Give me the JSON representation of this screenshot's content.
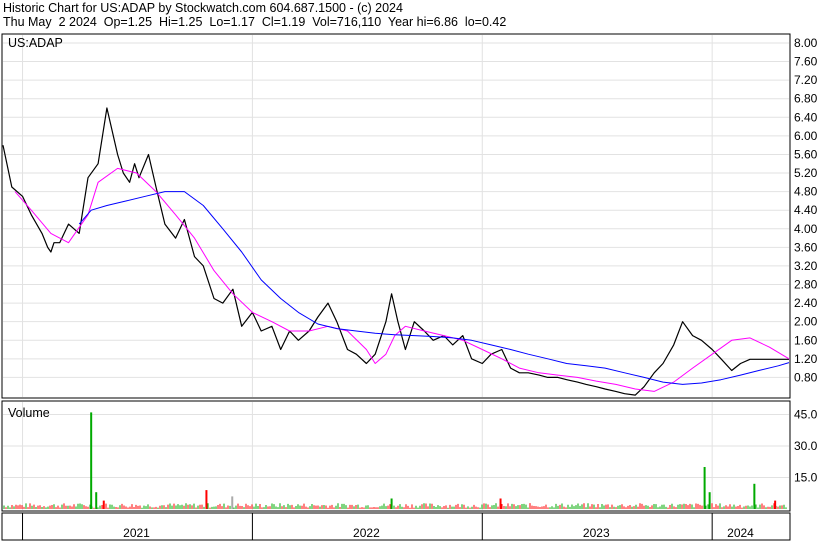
{
  "header": {
    "line1": "Historic Chart for US:ADAP by Stockwatch.com 604.687.1500 - (c) 2024",
    "line2": "Thu May  2 2024  Op=1.25  Hi=1.25  Lo=1.17  Cl=1.19  Vol=716,110  Year hi=6.86  lo=0.42"
  },
  "chart_data": [
    {
      "type": "line",
      "title": "US:ADAP",
      "yticks": [
        "8.00",
        "7.60",
        "7.20",
        "6.80",
        "6.40",
        "6.00",
        "5.60",
        "5.20",
        "4.80",
        "4.40",
        "4.00",
        "3.60",
        "3.20",
        "2.80",
        "2.40",
        "2.00",
        "1.60",
        "1.20",
        "0.80"
      ],
      "ylim": [
        0.4,
        8.15
      ],
      "grid": true,
      "series": [
        {
          "key": "price",
          "color": "#000000",
          "x": [
            "2020-12-01",
            "2020-12-15",
            "2021-01-01",
            "2021-01-15",
            "2021-02-01",
            "2021-02-10",
            "2021-02-15",
            "2021-02-20",
            "2021-03-01",
            "2021-03-15",
            "2021-04-01",
            "2021-04-15",
            "2021-05-01",
            "2021-05-15",
            "2021-06-01",
            "2021-06-10",
            "2021-06-20",
            "2021-06-28",
            "2021-07-05",
            "2021-07-20",
            "2021-08-01",
            "2021-08-15",
            "2021-09-01",
            "2021-09-15",
            "2021-10-01",
            "2021-10-15",
            "2021-11-01",
            "2021-11-15",
            "2021-12-01",
            "2021-12-15",
            "2022-01-01",
            "2022-01-15",
            "2022-02-01",
            "2022-02-15",
            "2022-03-01",
            "2022-03-15",
            "2022-04-01",
            "2022-04-15",
            "2022-05-01",
            "2022-05-15",
            "2022-06-01",
            "2022-06-15",
            "2022-07-01",
            "2022-07-15",
            "2022-08-01",
            "2022-08-10",
            "2022-08-20",
            "2022-09-01",
            "2022-09-15",
            "2022-10-01",
            "2022-10-15",
            "2022-11-01",
            "2022-11-15",
            "2022-12-01",
            "2022-12-15",
            "2023-01-01",
            "2023-01-15",
            "2023-02-01",
            "2023-02-15",
            "2023-03-01",
            "2023-03-15",
            "2023-04-01",
            "2023-04-15",
            "2023-05-01",
            "2023-05-15",
            "2023-06-01",
            "2023-06-15",
            "2023-07-01",
            "2023-07-15",
            "2023-08-01",
            "2023-08-15",
            "2023-09-01",
            "2023-09-15",
            "2023-10-01",
            "2023-10-15",
            "2023-11-01",
            "2023-11-15",
            "2023-12-01",
            "2023-12-15",
            "2024-01-01",
            "2024-01-15",
            "2024-02-01",
            "2024-02-15",
            "2024-03-01",
            "2024-03-15",
            "2024-04-01",
            "2024-04-15",
            "2024-05-02"
          ],
          "y": [
            5.8,
            4.9,
            4.7,
            4.3,
            3.9,
            3.6,
            3.5,
            3.7,
            3.7,
            4.1,
            3.9,
            5.1,
            5.4,
            6.6,
            5.6,
            5.2,
            5.0,
            5.4,
            5.1,
            5.6,
            4.9,
            4.1,
            3.8,
            4.2,
            3.4,
            3.2,
            2.5,
            2.4,
            2.7,
            1.9,
            2.2,
            1.8,
            1.9,
            1.4,
            1.8,
            1.6,
            1.8,
            2.1,
            2.4,
            2.0,
            1.4,
            1.3,
            1.1,
            1.3,
            2.0,
            2.6,
            2.0,
            1.4,
            2.0,
            1.8,
            1.6,
            1.7,
            1.5,
            1.7,
            1.2,
            1.1,
            1.3,
            1.4,
            1.0,
            0.9,
            0.9,
            0.85,
            0.8,
            0.8,
            0.75,
            0.7,
            0.65,
            0.6,
            0.55,
            0.5,
            0.45,
            0.42,
            0.6,
            0.9,
            1.1,
            1.5,
            2.0,
            1.7,
            1.6,
            1.4,
            1.2,
            0.95,
            1.1,
            1.19,
            1.19,
            1.19,
            1.19,
            1.19
          ]
        },
        {
          "key": "ma_short",
          "color": "#ff00ff",
          "x": [
            "2020-12-20",
            "2021-01-15",
            "2021-02-15",
            "2021-03-15",
            "2021-04-15",
            "2021-05-01",
            "2021-06-01",
            "2021-07-01",
            "2021-08-01",
            "2021-09-01",
            "2021-10-01",
            "2021-11-01",
            "2021-12-01",
            "2022-01-01",
            "2022-02-01",
            "2022-03-01",
            "2022-04-01",
            "2022-05-01",
            "2022-06-01",
            "2022-07-01",
            "2022-07-15",
            "2022-08-01",
            "2022-08-15",
            "2022-09-01",
            "2022-10-01",
            "2022-11-01",
            "2022-12-01",
            "2023-01-01",
            "2023-02-01",
            "2023-03-01",
            "2023-04-01",
            "2023-05-01",
            "2023-06-01",
            "2023-07-01",
            "2023-08-01",
            "2023-09-01",
            "2023-10-01",
            "2023-11-01",
            "2023-12-01",
            "2024-01-01",
            "2024-02-01",
            "2024-03-01",
            "2024-04-01",
            "2024-05-02"
          ],
          "y": [
            4.8,
            4.4,
            3.9,
            3.7,
            4.3,
            5.0,
            5.3,
            5.2,
            4.8,
            4.3,
            3.8,
            3.1,
            2.6,
            2.2,
            2.0,
            1.8,
            1.8,
            1.9,
            1.8,
            1.4,
            1.1,
            1.3,
            1.7,
            1.9,
            1.8,
            1.7,
            1.6,
            1.4,
            1.2,
            1.0,
            0.9,
            0.85,
            0.8,
            0.72,
            0.65,
            0.55,
            0.5,
            0.7,
            1.0,
            1.3,
            1.6,
            1.65,
            1.45,
            1.2
          ]
        },
        {
          "key": "ma_long",
          "color": "#0000ff",
          "x": [
            "2021-04-01",
            "2021-04-20",
            "2021-05-15",
            "2021-06-15",
            "2021-07-15",
            "2021-08-15",
            "2021-09-15",
            "2021-10-15",
            "2021-11-15",
            "2021-12-15",
            "2022-01-15",
            "2022-02-15",
            "2022-03-15",
            "2022-04-15",
            "2022-05-15",
            "2022-06-15",
            "2022-07-15",
            "2022-08-15",
            "2022-09-15",
            "2022-10-15",
            "2022-11-15",
            "2022-12-15",
            "2023-01-15",
            "2023-02-15",
            "2023-03-15",
            "2023-04-15",
            "2023-05-15",
            "2023-06-15",
            "2023-07-15",
            "2023-08-15",
            "2023-09-15",
            "2023-10-15",
            "2023-11-15",
            "2023-12-15",
            "2024-01-15",
            "2024-02-15",
            "2024-03-15",
            "2024-04-15",
            "2024-05-02"
          ],
          "y": [
            4.1,
            4.4,
            4.5,
            4.6,
            4.7,
            4.8,
            4.8,
            4.5,
            4.0,
            3.5,
            2.9,
            2.5,
            2.2,
            1.95,
            1.85,
            1.8,
            1.75,
            1.72,
            1.7,
            1.68,
            1.65,
            1.6,
            1.5,
            1.4,
            1.3,
            1.2,
            1.1,
            1.05,
            1.0,
            0.9,
            0.8,
            0.7,
            0.65,
            0.68,
            0.75,
            0.85,
            0.95,
            1.05,
            1.12
          ]
        }
      ]
    },
    {
      "type": "bar",
      "title": "Volume",
      "yticks": [
        "45.0",
        "30.0",
        "15.0"
      ],
      "ylim": [
        0,
        50
      ],
      "grid": true,
      "x_labels": [
        "2021",
        "2022",
        "2023",
        "2024"
      ],
      "base_volume": 2.0,
      "spikes": [
        {
          "x": "2021-04-20",
          "value": 46.0,
          "color": "#00aa00"
        },
        {
          "x": "2021-04-28",
          "value": 8.0,
          "color": "#00aa00"
        },
        {
          "x": "2021-05-10",
          "value": 4.0,
          "color": "#ff0000"
        },
        {
          "x": "2021-10-20",
          "value": 9.0,
          "color": "#ff0000"
        },
        {
          "x": "2021-11-30",
          "value": 6.0,
          "color": "#aaaaaa"
        },
        {
          "x": "2022-08-10",
          "value": 5.0,
          "color": "#00aa00"
        },
        {
          "x": "2023-01-30",
          "value": 5.0,
          "color": "#ff0000"
        },
        {
          "x": "2023-12-20",
          "value": 20.0,
          "color": "#00aa00"
        },
        {
          "x": "2023-12-28",
          "value": 8.0,
          "color": "#00aa00"
        },
        {
          "x": "2024-03-08",
          "value": 12.0,
          "color": "#00aa00"
        },
        {
          "x": "2024-04-10",
          "value": 4.0,
          "color": "#ff0000"
        }
      ]
    }
  ]
}
